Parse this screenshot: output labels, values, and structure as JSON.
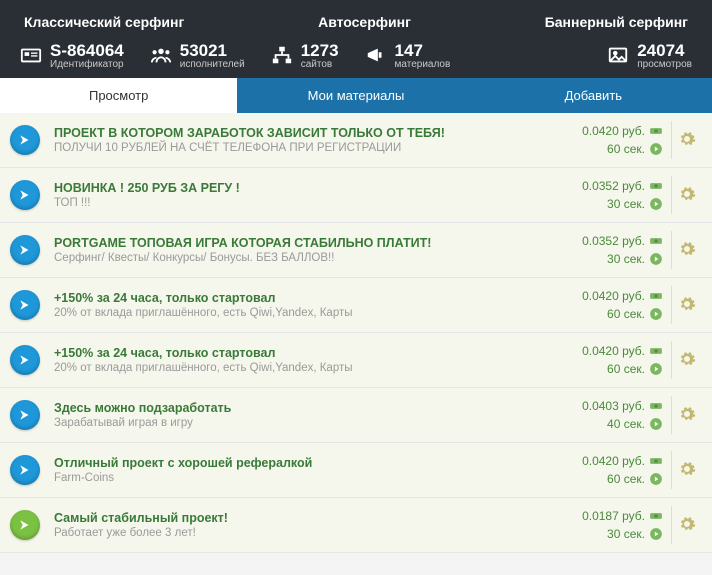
{
  "top_tabs": {
    "classic": "Классический серфинг",
    "auto": "Автосерфинг",
    "banner": "Баннерный серфинг"
  },
  "stats": {
    "id": {
      "value": "S-864064",
      "label": "Идентификатор"
    },
    "exec": {
      "value": "53021",
      "label": "исполнителей"
    },
    "sites": {
      "value": "1273",
      "label": "сайтов"
    },
    "materials": {
      "value": "147",
      "label": "материалов"
    },
    "views": {
      "value": "24074",
      "label": "просмотров"
    }
  },
  "blue_tabs": {
    "view": "Просмотр",
    "my": "Мои материалы",
    "add": "Добавить"
  },
  "rows": [
    {
      "color": "blue",
      "title": "ПРОЕКТ В КОТОРОМ ЗАРАБОТОК ЗАВИСИТ ТОЛЬКО ОТ ТЕБЯ!",
      "sub": "ПОЛУЧИ 10 РУБЛЕЙ НА СЧЁТ ТЕЛЕФОНА ПРИ РЕГИСТРАЦИИ",
      "price": "0.0420 руб.",
      "time": "60 сек."
    },
    {
      "color": "blue",
      "title": "НОВИНКА ! 250 РУБ ЗА РЕГУ !",
      "sub": "ТОП !!!",
      "price": "0.0352 руб.",
      "time": "30 сек."
    },
    {
      "color": "blue",
      "title": "PORTGAME ТОПОВАЯ ИГРА КОТОРАЯ СТАБИЛЬНО ПЛАТИТ!",
      "sub": "Серфинг/ Квесты/ Конкурсы/ Бонусы. БЕЗ БАЛЛОВ!!",
      "price": "0.0352 руб.",
      "time": "30 сек."
    },
    {
      "color": "blue",
      "title": "+150% за 24 часа, только стартовал",
      "sub": "20% от вклада приглашённого, есть Qiwi,Yandex, Карты",
      "price": "0.0420 руб.",
      "time": "60 сек.",
      "nocap": true
    },
    {
      "color": "blue",
      "title": "+150% за 24 часа, только стартовал",
      "sub": "20% от вклада приглашённого, есть Qiwi,Yandex, Карты",
      "price": "0.0420 руб.",
      "time": "60 сек.",
      "nocap": true
    },
    {
      "color": "blue",
      "title": "Здесь можно подзаработать",
      "sub": "Зарабатывай играя в игру",
      "price": "0.0403 руб.",
      "time": "40 сек.",
      "nocap": true
    },
    {
      "color": "blue",
      "title": "Отличный проект с хорошей рефералкой",
      "sub": "Farm-Coins",
      "price": "0.0420 руб.",
      "time": "60 сек.",
      "nocap": true
    },
    {
      "color": "green",
      "title": "Самый стабильный проект!",
      "sub": "Работает уже более 3 лет!",
      "price": "0.0187 руб.",
      "time": "30 сек.",
      "nocap": true
    }
  ]
}
